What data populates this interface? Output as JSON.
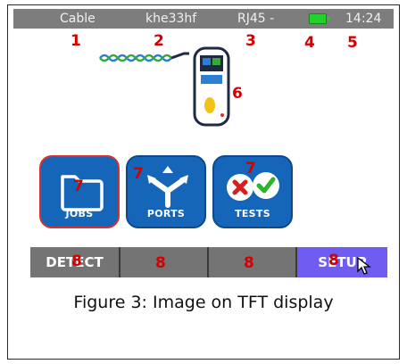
{
  "status_bar": {
    "cable": "Cable",
    "cable_id": "khe33hf",
    "connector": "RJ45 -",
    "time": "14:24"
  },
  "callouts": {
    "n1": "1",
    "n2": "2",
    "n3": "3",
    "n4": "4",
    "n5": "5",
    "n6": "6",
    "n7a": "7",
    "n7b": "7",
    "n7c": "7",
    "n8a": "8",
    "n8b": "8",
    "n8c": "8",
    "n8d": "8"
  },
  "apps": {
    "jobs": "JOBS",
    "ports": "PORTS",
    "tests": "TESTS"
  },
  "softkeys": {
    "k1": "DETECT",
    "k2": "",
    "k3": "",
    "k4": "SETUP"
  },
  "caption": "Figure 3: Image on TFT display",
  "colors": {
    "status_bar": "#7d7d7d",
    "app_button": "#1566b8",
    "softkey": "#747474",
    "softkey_active": "#6e5df0",
    "callout": "#d40000"
  }
}
